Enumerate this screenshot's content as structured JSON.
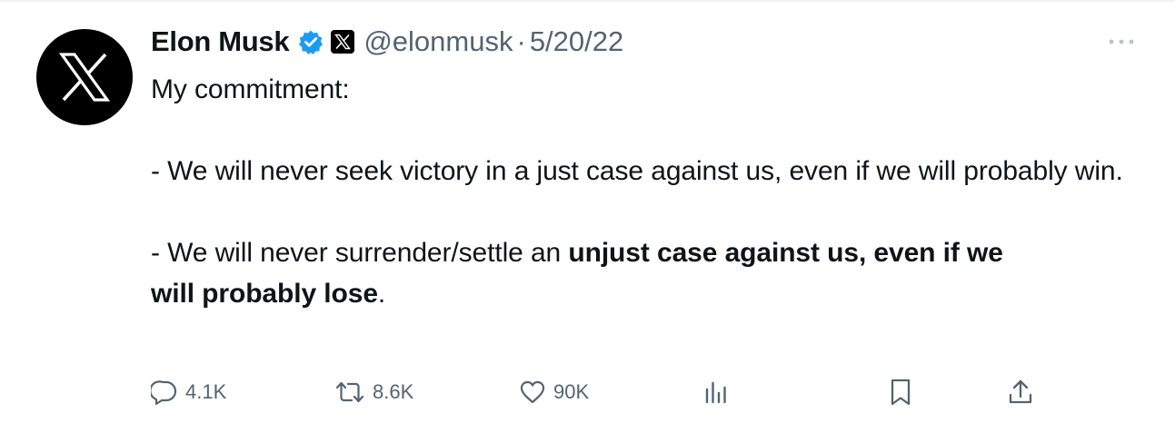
{
  "author": {
    "name": "Elon Musk",
    "handle": "@elonmusk",
    "separator": "·",
    "date": "5/20/22",
    "avatar_icon": "x-logo-icon",
    "verified_icon": "verified-badge-icon",
    "affiliate_icon": "x-affiliate-icon"
  },
  "tweet": {
    "line1": "My commitment:",
    "para1": "- We will never seek victory in a just case against us, even if we will probably win.",
    "para2_prefix": "- We will never surrender/settle an ",
    "para2_bold_a": "unjust case against us, even if we",
    "para2_bold_b": "will probably lose",
    "para2_suffix": "."
  },
  "actions": {
    "replies": "4.1K",
    "retweets": "8.6K",
    "likes": "90K"
  },
  "colors": {
    "text": "#0f1419",
    "muted": "#536471",
    "verified": "#1d9bf0",
    "avatar_bg": "#000000"
  }
}
